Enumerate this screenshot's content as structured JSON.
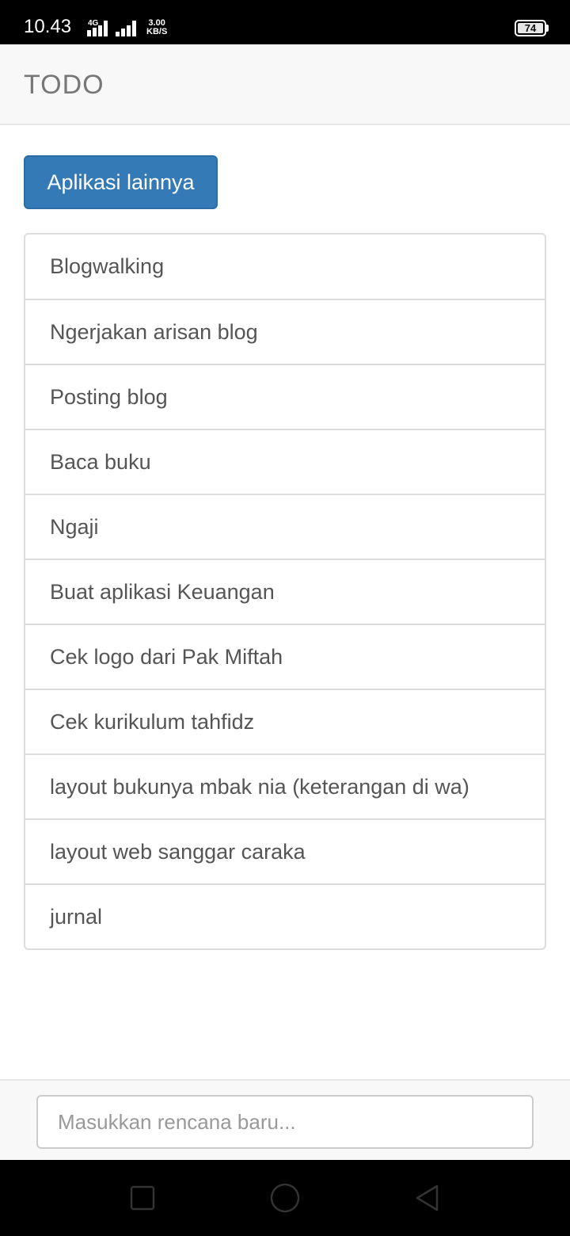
{
  "status_bar": {
    "time": "10.43",
    "network_type": "4G",
    "speed_value": "3.00",
    "speed_unit": "KB/S",
    "battery_level": "74",
    "icons": [
      "signal-4g-icon",
      "signal-strength-icon",
      "battery-icon"
    ]
  },
  "header": {
    "title": "TODO"
  },
  "apps_button": {
    "label": "Aplikasi lainnya",
    "color": "#337ab7"
  },
  "todo_items": [
    "Blogwalking",
    "Ngerjakan arisan blog",
    "Posting blog",
    "Baca buku",
    "Ngaji",
    "Buat aplikasi Keuangan",
    "Cek logo dari Pak Miftah",
    "Cek kurikulum tahfidz",
    "layout bukunya mbak nia (keterangan di wa)",
    "layout web sanggar caraka",
    "jurnal"
  ],
  "new_plan": {
    "value": "",
    "placeholder": "Masukkan rencana baru..."
  },
  "nav_bar": {
    "icons": [
      "recents-square-icon",
      "home-circle-icon",
      "back-triangle-icon"
    ]
  }
}
